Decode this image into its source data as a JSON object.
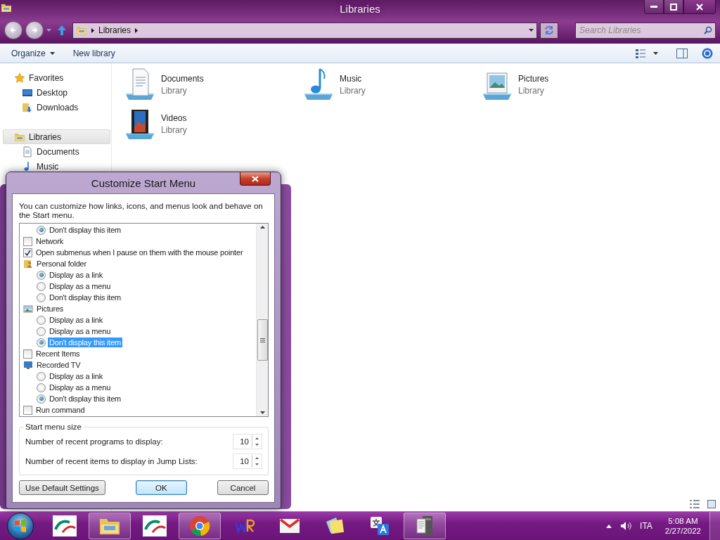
{
  "window": {
    "title": "Libraries"
  },
  "address_bar": {
    "crumbs": [
      "Libraries"
    ]
  },
  "search": {
    "placeholder": "Search Libraries"
  },
  "toolbar": {
    "buttons": [
      {
        "label": "Organize",
        "dropdown": true
      },
      {
        "label": "New library",
        "dropdown": false
      }
    ]
  },
  "sidebar": {
    "sections": [
      {
        "label": "Favorites",
        "kind": "favorites",
        "selected": false,
        "children": [
          {
            "label": "Desktop",
            "kind": "desktop"
          },
          {
            "label": "Downloads",
            "kind": "downloads"
          }
        ]
      },
      {
        "label": "Libraries",
        "kind": "libraries",
        "selected": true,
        "children": [
          {
            "label": "Documents",
            "kind": "documents"
          },
          {
            "label": "Music",
            "kind": "music"
          }
        ]
      }
    ]
  },
  "libraries": [
    {
      "name": "Documents",
      "type": "Library",
      "kind": "documents"
    },
    {
      "name": "Music",
      "type": "Library",
      "kind": "music"
    },
    {
      "name": "Pictures",
      "type": "Library",
      "kind": "pictures"
    },
    {
      "name": "Videos",
      "type": "Library",
      "kind": "videos"
    }
  ],
  "dialog": {
    "title": "Customize Start Menu",
    "description": "You can customize how links, icons, and menus look and behave on the Start menu.",
    "options": [
      {
        "kind": "radio",
        "label": "Don't display this item",
        "selected": true,
        "focused": false
      },
      {
        "kind": "checkbox",
        "label": "Network",
        "checked": false
      },
      {
        "kind": "checkbox",
        "label": "Open submenus when I pause on them with the mouse pointer",
        "checked": true
      },
      {
        "kind": "group",
        "label": "Personal folder"
      },
      {
        "kind": "radio",
        "label": "Display as a link",
        "selected": true,
        "focused": false
      },
      {
        "kind": "radio",
        "label": "Display as a menu",
        "selected": false,
        "focused": false
      },
      {
        "kind": "radio",
        "label": "Don't display this item",
        "selected": false,
        "focused": false
      },
      {
        "kind": "group",
        "label": "Pictures"
      },
      {
        "kind": "radio",
        "label": "Display as a link",
        "selected": false,
        "focused": false
      },
      {
        "kind": "radio",
        "label": "Display as a menu",
        "selected": false,
        "focused": false
      },
      {
        "kind": "radio",
        "label": "Don't display this item",
        "selected": true,
        "focused": true
      },
      {
        "kind": "checkbox",
        "label": "Recent Items",
        "checked": false
      },
      {
        "kind": "group",
        "label": "Recorded TV"
      },
      {
        "kind": "radio",
        "label": "Display as a link",
        "selected": false,
        "focused": false
      },
      {
        "kind": "radio",
        "label": "Display as a menu",
        "selected": false,
        "focused": false
      },
      {
        "kind": "radio",
        "label": "Don't display this item",
        "selected": true,
        "focused": false
      },
      {
        "kind": "checkbox",
        "label": "Run command",
        "checked": false
      }
    ],
    "size_group": {
      "title": "Start menu size",
      "rows": [
        {
          "label": "Number of recent programs to display:",
          "value": "10"
        },
        {
          "label": "Number of recent items to display in Jump Lists:",
          "value": "10"
        }
      ]
    },
    "buttons": [
      {
        "label": "Use Default Settings",
        "default": false
      },
      {
        "label": "OK",
        "default": true
      },
      {
        "label": "Cancel",
        "default": false
      }
    ]
  },
  "taskbar": {
    "apps": [
      {
        "kind": "bank",
        "open": false
      },
      {
        "kind": "explorer",
        "open": true
      },
      {
        "kind": "bank",
        "open": false
      },
      {
        "kind": "chrome",
        "open": true
      },
      {
        "kind": "wr",
        "open": false
      },
      {
        "kind": "mail",
        "open": false
      },
      {
        "kind": "notes",
        "open": false
      },
      {
        "kind": "translate",
        "open": false
      },
      {
        "kind": "server",
        "open": true
      }
    ],
    "language": "ITA",
    "time": "5:08 AM",
    "date": "2/27/2022"
  }
}
